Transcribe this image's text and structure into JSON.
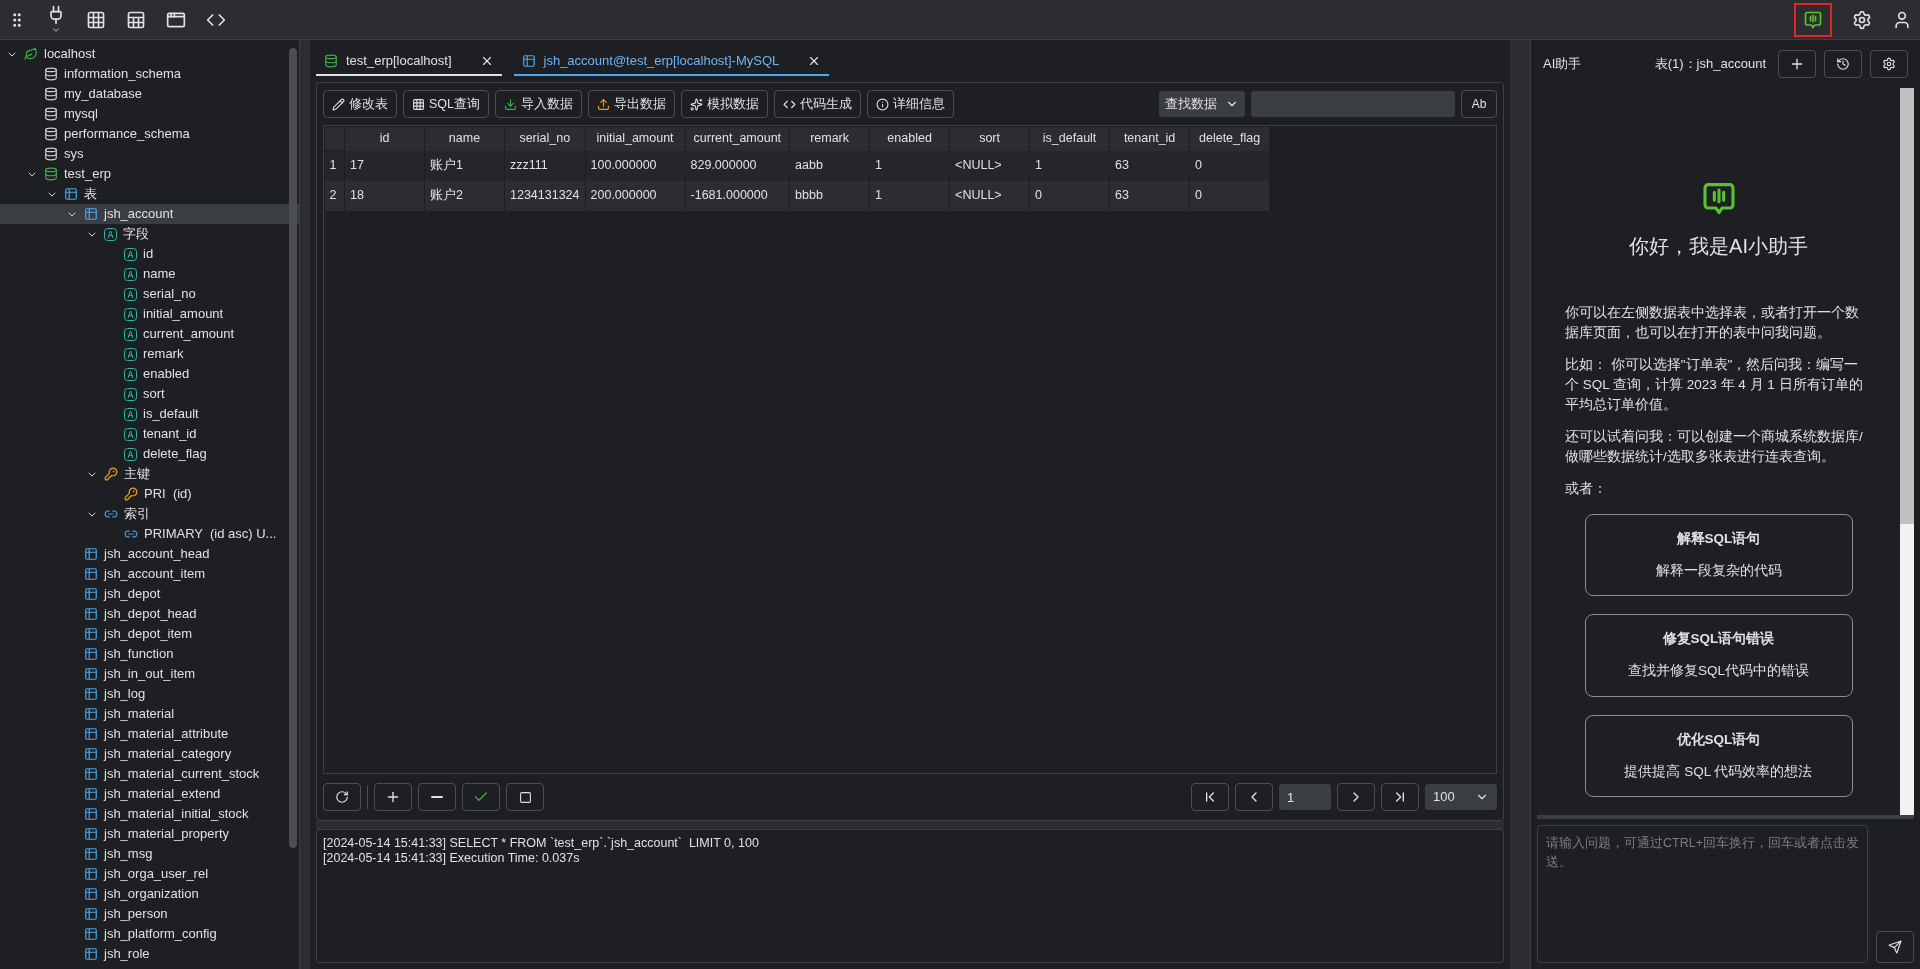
{
  "tree": [
    {
      "label": "localhost",
      "kind": "server",
      "expanded": true,
      "selected": false,
      "children": [
        {
          "label": "information_schema",
          "kind": "database",
          "selected": false
        },
        {
          "label": "my_database",
          "kind": "database",
          "selected": false
        },
        {
          "label": "mysql",
          "kind": "database",
          "selected": false
        },
        {
          "label": "performance_schema",
          "kind": "database",
          "selected": false
        },
        {
          "label": "sys",
          "kind": "database",
          "selected": false
        },
        {
          "label": "test_erp",
          "kind": "database_open",
          "expanded": true,
          "selected": false,
          "children": [
            {
              "label": "表",
              "kind": "table_folder",
              "expanded": true,
              "selected": false,
              "children": [
                {
                  "label": "jsh_account",
                  "kind": "table",
                  "expanded": true,
                  "selected": true,
                  "children": [
                    {
                      "label": "字段",
                      "kind": "column_folder",
                      "expanded": true,
                      "selected": false,
                      "children": [
                        {
                          "label": "id",
                          "kind": "column",
                          "selected": false
                        },
                        {
                          "label": "name",
                          "kind": "column",
                          "selected": false
                        },
                        {
                          "label": "serial_no",
                          "kind": "column",
                          "selected": false
                        },
                        {
                          "label": "initial_amount",
                          "kind": "column",
                          "selected": false
                        },
                        {
                          "label": "current_amount",
                          "kind": "column",
                          "selected": false
                        },
                        {
                          "label": "remark",
                          "kind": "column",
                          "selected": false
                        },
                        {
                          "label": "enabled",
                          "kind": "column",
                          "selected": false
                        },
                        {
                          "label": "sort",
                          "kind": "column",
                          "selected": false
                        },
                        {
                          "label": "is_default",
                          "kind": "column",
                          "selected": false
                        },
                        {
                          "label": "tenant_id",
                          "kind": "column",
                          "selected": false
                        },
                        {
                          "label": "delete_flag",
                          "kind": "column",
                          "selected": false
                        }
                      ]
                    },
                    {
                      "label": "主键",
                      "kind": "key_folder",
                      "expanded": true,
                      "selected": false,
                      "children": [
                        {
                          "label": "PRI  (id)",
                          "kind": "key",
                          "selected": false
                        }
                      ]
                    },
                    {
                      "label": "索引",
                      "kind": "index_folder",
                      "expanded": true,
                      "selected": false,
                      "children": [
                        {
                          "label": "PRIMARY  (id asc) U...",
                          "kind": "index",
                          "selected": false
                        }
                      ]
                    }
                  ]
                },
                {
                  "label": "jsh_account_head",
                  "kind": "table",
                  "selected": false
                },
                {
                  "label": "jsh_account_item",
                  "kind": "table",
                  "selected": false
                },
                {
                  "label": "jsh_depot",
                  "kind": "table",
                  "selected": false
                },
                {
                  "label": "jsh_depot_head",
                  "kind": "table",
                  "selected": false
                },
                {
                  "label": "jsh_depot_item",
                  "kind": "table",
                  "selected": false
                },
                {
                  "label": "jsh_function",
                  "kind": "table",
                  "selected": false
                },
                {
                  "label": "jsh_in_out_item",
                  "kind": "table",
                  "selected": false
                },
                {
                  "label": "jsh_log",
                  "kind": "table",
                  "selected": false
                },
                {
                  "label": "jsh_material",
                  "kind": "table",
                  "selected": false
                },
                {
                  "label": "jsh_material_attribute",
                  "kind": "table",
                  "selected": false
                },
                {
                  "label": "jsh_material_category",
                  "kind": "table",
                  "selected": false
                },
                {
                  "label": "jsh_material_current_stock",
                  "kind": "table",
                  "selected": false
                },
                {
                  "label": "jsh_material_extend",
                  "kind": "table",
                  "selected": false
                },
                {
                  "label": "jsh_material_initial_stock",
                  "kind": "table",
                  "selected": false
                },
                {
                  "label": "jsh_material_property",
                  "kind": "table",
                  "selected": false
                },
                {
                  "label": "jsh_msg",
                  "kind": "table",
                  "selected": false
                },
                {
                  "label": "jsh_orga_user_rel",
                  "kind": "table",
                  "selected": false
                },
                {
                  "label": "jsh_organization",
                  "kind": "table",
                  "selected": false
                },
                {
                  "label": "jsh_person",
                  "kind": "table",
                  "selected": false
                },
                {
                  "label": "jsh_platform_config",
                  "kind": "table",
                  "selected": false
                },
                {
                  "label": "jsh_role",
                  "kind": "table",
                  "selected": false
                }
              ]
            }
          ]
        }
      ]
    }
  ],
  "tabs": [
    {
      "label": "test_erp[localhost]",
      "kind": "database",
      "selected": false
    },
    {
      "label": "jsh_account@test_erp[localhost]-MySQL",
      "kind": "table",
      "selected": true
    }
  ],
  "toolbar": [
    {
      "label": "修改表",
      "kind": "edit"
    },
    {
      "label": "SQL查询",
      "kind": "query"
    },
    {
      "label": "导入数据",
      "kind": "import"
    },
    {
      "label": "导出数据",
      "kind": "export"
    },
    {
      "label": "模拟数据",
      "kind": "mock"
    },
    {
      "label": "代码生成",
      "kind": "code"
    },
    {
      "label": "详细信息",
      "kind": "info"
    }
  ],
  "search": {
    "mode": "查找数据",
    "case_button": "Ab"
  },
  "table": {
    "columns": [
      "id",
      "name",
      "serial_no",
      "initial_amount",
      "current_amount",
      "remark",
      "enabled",
      "sort",
      "is_default",
      "tenant_id",
      "delete_flag"
    ],
    "rows": [
      {
        "number": "1",
        "cells": [
          "17",
          "账户1",
          "zzz111",
          "100.000000",
          "829.000000",
          "aabb",
          "1",
          "<NULL>",
          "1",
          "63",
          "0"
        ]
      },
      {
        "number": "2",
        "cells": [
          "18",
          "账户2",
          "1234131324",
          "200.000000",
          "-1681.000000",
          "bbbb",
          "1",
          "<NULL>",
          "0",
          "63",
          "0"
        ]
      }
    ]
  },
  "pager": {
    "page": "1",
    "page_size": "100"
  },
  "log": [
    "[2024-05-14 15:41:33] SELECT * FROM `test_erp`.`jsh_account`  LIMIT 0, 100",
    "[2024-05-14 15:41:33] Execution Time: 0.037s"
  ],
  "assistant": {
    "title": "AI助手",
    "context": "表(1)：jsh_account",
    "active": true,
    "greeting": "你好，我是AI小助手",
    "paragraphs": [
      "你可以在左侧数据表中选择表，或者打开一个数据库页面，也可以在打开的表中问我问题。",
      "比如： 你可以选择\"订单表\"，然后问我：编写一个 SQL 查询，计算 2023 年 4 月 1 日所有订单的平均总订单价值。",
      "还可以试着问我：可以创建一个商城系统数据库/做哪些数据统计/选取多张表进行连表查询。"
    ],
    "or_label": "或者：",
    "cards": [
      {
        "title": "解释SQL语句",
        "description": "解释一段复杂的代码"
      },
      {
        "title": "修复SQL语句错误",
        "description": "查找并修复SQL代码中的错误"
      },
      {
        "title": "优化SQL语句",
        "description": "提供提高 SQL 代码效率的想法"
      }
    ],
    "placeholder": "请输入问题，可通过CTRL+回车换行，回车或者点击发送。"
  }
}
